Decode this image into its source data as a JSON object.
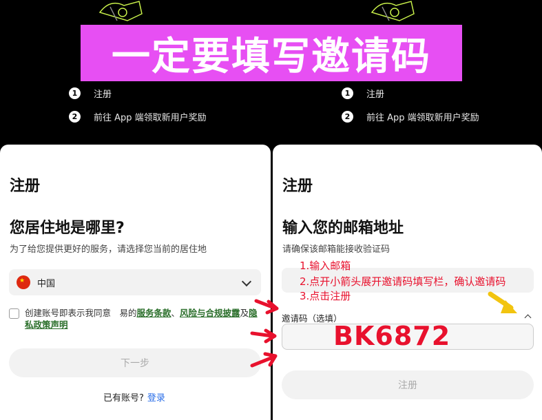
{
  "banner": {
    "text": "一定要填写邀请码"
  },
  "steps": [
    {
      "num": "1",
      "label": "注册"
    },
    {
      "num": "2",
      "label": "前往 App 端领取新用户奖励"
    }
  ],
  "left": {
    "title": "注册",
    "question": "您居住地是哪里?",
    "subtitle": "为了给您提供更好的服务，请选择您当前的居住地",
    "country": "中国",
    "agree_prefix": "创建账号即表示我同意　易的",
    "terms": "服务条款",
    "sep": "、",
    "risk": "风险与合规披露",
    "and": "及",
    "privacy": "隐私政策声明",
    "next_button": "下一步",
    "have_account": "已有账号?",
    "login": "登录"
  },
  "right": {
    "title": "注册",
    "question": "输入您的邮箱地址",
    "subtitle": "请确保该邮箱能接收验证码",
    "invite_label": "邀请码（选填）",
    "invite_code": "BK6872",
    "signup_button": "注册"
  },
  "annotations": [
    "1.输入邮箱",
    "2.点开小箭头展开邀请码填写栏，确认邀请码",
    "3.点击注册"
  ],
  "colors": {
    "banner": "#e74ff3",
    "annotation_red": "#e8112d",
    "link_green": "#2a6e2a",
    "link_blue": "#2a6ee8",
    "arrow_yellow": "#f2c40f"
  }
}
